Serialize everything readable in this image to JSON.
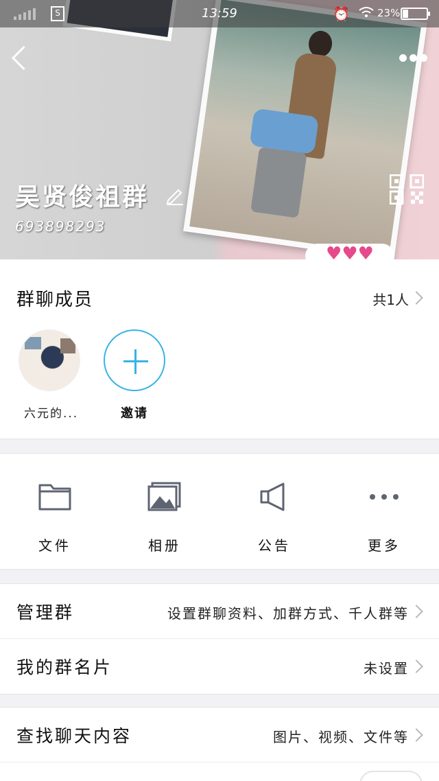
{
  "status_bar": {
    "time": "13:59",
    "battery_percent": "23%",
    "battery_level": 0.23,
    "sim_label": "S"
  },
  "header": {
    "group_name": "吴贤俊祖群",
    "group_id": "693898293",
    "sticker": "♥♥♥"
  },
  "members": {
    "title": "群聊成员",
    "count": "共1人",
    "items": [
      {
        "name": "六元的..."
      }
    ],
    "invite_label": "邀请"
  },
  "functions": [
    {
      "label": "文件",
      "icon": "folder-icon"
    },
    {
      "label": "相册",
      "icon": "album-icon"
    },
    {
      "label": "公告",
      "icon": "announcement-icon"
    },
    {
      "label": "更多",
      "icon": "more-dots-icon"
    }
  ],
  "rows": {
    "manage": {
      "title": "管理群",
      "value": "设置群聊资料、加群方式、千人群等"
    },
    "card": {
      "title": "我的群名片",
      "value": "未设置"
    },
    "search": {
      "title": "查找聊天内容",
      "value": "图片、视频、文件等"
    }
  },
  "colors": {
    "accent": "#38b3e6",
    "icon_gray": "#5f6473",
    "background": "#f2f2f4"
  }
}
